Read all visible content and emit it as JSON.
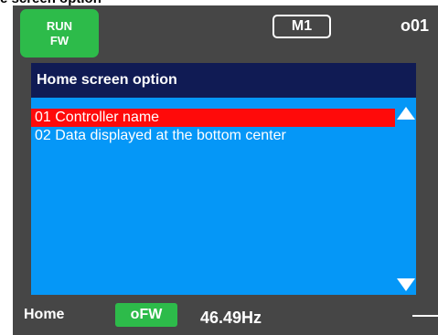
{
  "caption": "e screen option",
  "header": {
    "run_status_line1": "RUN",
    "run_status_line2": "FW",
    "mode": "M1",
    "parameter_code": "o01"
  },
  "panel": {
    "title": "Home screen option",
    "options": [
      {
        "label": "01 Controller name",
        "selected": true
      },
      {
        "label": "02 Data displayed at the bottom center",
        "selected": false
      }
    ]
  },
  "status_bar": {
    "screen": "Home",
    "direction": "oFW",
    "frequency": "46.49Hz"
  },
  "colors": {
    "bezel": "#464646",
    "panel": "#0597f7",
    "header": "#101b54",
    "selection": "#ff0a0a",
    "status_green": "#2dbb4a"
  },
  "icons": [
    "scroll-up-arrow-icon",
    "scroll-down-arrow-icon"
  ]
}
